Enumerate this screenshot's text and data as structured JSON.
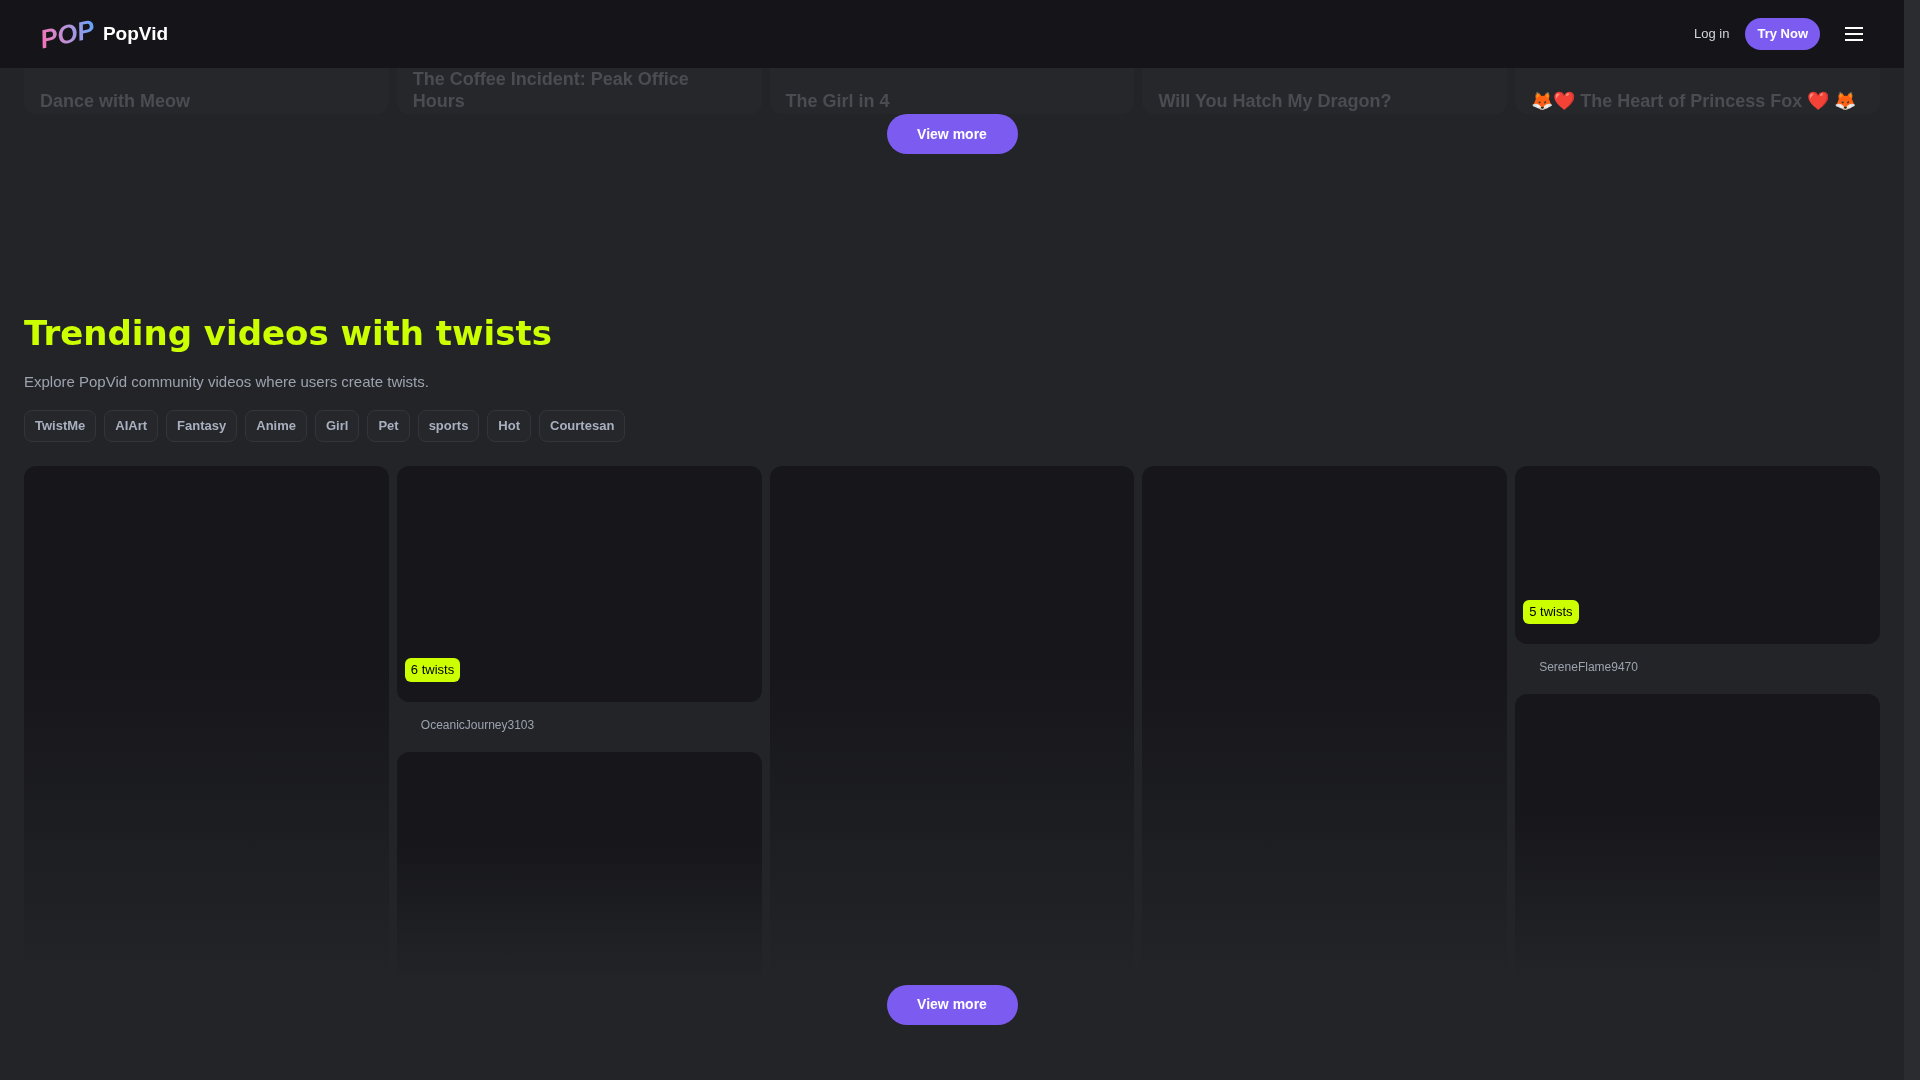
{
  "header": {
    "logo_mark": "POP",
    "brand": "PopVid",
    "login": "Log in",
    "cta": "Try Now"
  },
  "top_row": {
    "titles": [
      "Dance with Meow",
      "The Coffee Incident: Peak Office Hours",
      "The Girl in 4",
      "Will You Hatch My Dragon?",
      "🦊❤️ The Heart of Princess Fox ❤️ 🦊"
    ],
    "button": "View more"
  },
  "trending": {
    "title": "Trending videos with twists",
    "subtitle": "Explore PopVid community videos where users create twists.",
    "tags": [
      "TwistMe",
      "AIArt",
      "Fantasy",
      "Anime",
      "Girl",
      "Pet",
      "sports",
      "Hot",
      "Courtesan"
    ],
    "columns": [
      [
        {
          "kind": "tall"
        }
      ],
      [
        {
          "kind": "card",
          "badge": "6 twists",
          "user": "OceanicJourney3103"
        },
        {
          "kind": "tall"
        }
      ],
      [
        {
          "kind": "tall"
        }
      ],
      [
        {
          "kind": "tall"
        }
      ],
      [
        {
          "kind": "short",
          "badge": "5 twists",
          "user": "SereneFlame9470"
        },
        {
          "kind": "tall"
        }
      ]
    ],
    "button": "View more"
  }
}
